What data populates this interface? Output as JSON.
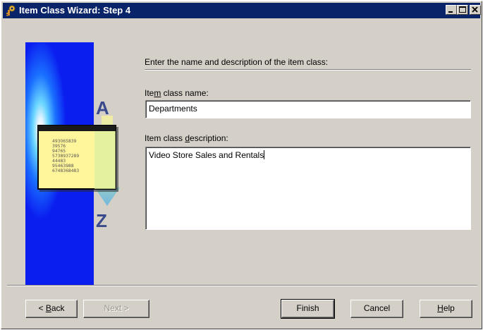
{
  "window": {
    "title": "Item Class Wizard: Step 4",
    "app_icon": "wizard-key-icon",
    "controls": [
      "minimize-icon",
      "maximize-icon",
      "close-icon"
    ]
  },
  "illustration": {
    "letter_top": "A",
    "letter_bottom": "Z",
    "numbers": [
      "493065839",
      "39576",
      "94765",
      "5738937289",
      "44483",
      "95463988",
      "6748368483"
    ]
  },
  "form": {
    "instruction": "Enter the name and description of the item class:",
    "name_label": {
      "before": "Ite",
      "accel": "m",
      "after": " class name:"
    },
    "name_value": "Departments",
    "desc_label": {
      "before": "Item class ",
      "accel": "d",
      "after": "escription:"
    },
    "desc_value": "Video Store Sales and Rentals"
  },
  "buttons": {
    "back": {
      "prefix": "< ",
      "accel": "B",
      "rest": "ack"
    },
    "next": "Next >",
    "finish": "Finish",
    "cancel": "Cancel",
    "help": {
      "accel": "H",
      "rest": "elp"
    }
  },
  "colors": {
    "titlebar": "#0a246a",
    "dialog_face": "#d4d0c8",
    "art_blue": "#0a1ef0",
    "card_yellow": "#fff59a",
    "letter_blue": "#3a4a8c"
  }
}
